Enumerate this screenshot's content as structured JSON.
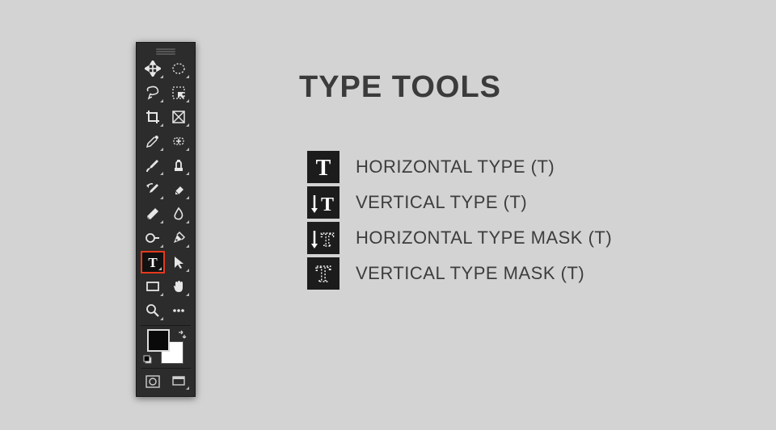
{
  "title": "TYPE TOOLS",
  "variants": [
    {
      "id": "horizontal-type",
      "label": "HORIZONTAL TYPE (T)"
    },
    {
      "id": "vertical-type",
      "label": "VERTICAL TYPE (T)"
    },
    {
      "id": "horizontal-type-mask",
      "label": "HORIZONTAL TYPE MASK (T)"
    },
    {
      "id": "vertical-type-mask",
      "label": "VERTICAL TYPE MASK (T)"
    }
  ],
  "toolbar": [
    {
      "name": "move-tool",
      "col": 0
    },
    {
      "name": "marquee-tool",
      "col": 1
    },
    {
      "name": "lasso-tool",
      "col": 0
    },
    {
      "name": "quick-selection-tool",
      "col": 1
    },
    {
      "name": "crop-tool",
      "col": 0
    },
    {
      "name": "frame-tool",
      "col": 1
    },
    {
      "name": "eyedropper-tool",
      "col": 0
    },
    {
      "name": "patch-tool",
      "col": 1
    },
    {
      "name": "brush-tool",
      "col": 0
    },
    {
      "name": "clone-stamp-tool",
      "col": 1
    },
    {
      "name": "history-brush-tool",
      "col": 0
    },
    {
      "name": "eraser-tool",
      "col": 1
    },
    {
      "name": "gradient-tool",
      "col": 0
    },
    {
      "name": "blur-tool",
      "col": 1
    },
    {
      "name": "dodge-tool",
      "col": 0
    },
    {
      "name": "pen-tool",
      "col": 1
    },
    {
      "name": "type-tool",
      "col": 0,
      "selected": true
    },
    {
      "name": "path-selection-tool",
      "col": 1
    },
    {
      "name": "rectangle-shape-tool",
      "col": 0
    },
    {
      "name": "hand-tool",
      "col": 1
    },
    {
      "name": "zoom-tool",
      "col": 0
    },
    {
      "name": "edit-toolbar",
      "col": 1
    }
  ],
  "colors": {
    "foreground": "#000000",
    "background": "#ffffff"
  },
  "modes": {
    "quickmask": "quick-mask-mode",
    "screenmode": "screen-mode"
  }
}
